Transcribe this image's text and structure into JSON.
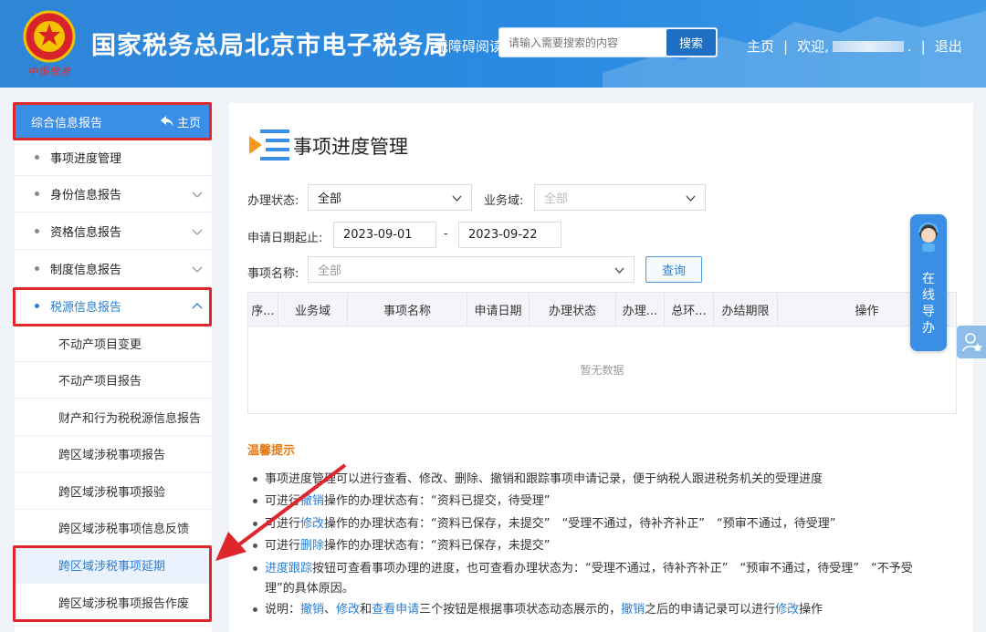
{
  "header": {
    "emblem_text": "中国税务",
    "site_title": "国家税务总局北京市电子税务局",
    "read_mode": "无障碍阅读",
    "search_placeholder": "请输入需要搜索的内容",
    "search_button": "搜索",
    "nav_home": "主页",
    "nav_sep": "|",
    "welcome": "欢迎,",
    "welcome_suffix": ".",
    "logout": "退出"
  },
  "sidebar": {
    "header_label": "综合信息报告",
    "home_label": "主页",
    "items": [
      {
        "label": "事项进度管理"
      },
      {
        "label": "身份信息报告"
      },
      {
        "label": "资格信息报告"
      },
      {
        "label": "制度信息报告"
      },
      {
        "label": "税源信息报告"
      }
    ],
    "sub_items": [
      {
        "label": "不动产项目变更"
      },
      {
        "label": "不动产项目报告"
      },
      {
        "label": "财产和行为税税源信息报告"
      },
      {
        "label": "跨区域涉税事项报告"
      },
      {
        "label": "跨区域涉税事项报验"
      },
      {
        "label": "跨区域涉税事项信息反馈"
      },
      {
        "label": "跨区域涉税事项延期"
      },
      {
        "label": "跨区域涉税事项报告作废"
      }
    ]
  },
  "main": {
    "title": "事项进度管理",
    "filters": {
      "status_label": "办理状态:",
      "status_value": "全部",
      "domain_label": "业务域:",
      "domain_value": "全部",
      "date_label": "申请日期起止:",
      "date_from": "2023-09-01",
      "date_sep": "-",
      "date_to": "2023-09-22",
      "item_label": "事项名称:",
      "item_value": "全部",
      "query_button": "查询"
    },
    "table": {
      "columns": [
        "序...",
        "业务域",
        "事项名称",
        "申请日期",
        "办理状态",
        "办理...",
        "总环...",
        "办结期限",
        "操作"
      ],
      "empty_text": "暂无数据"
    },
    "tips": {
      "title": "温馨提示",
      "line1": "事项进度管理可以进行查看、修改、删除、撤销和跟踪事项申请记录，便于纳税人跟进税务机关的受理进度",
      "line2_a": "可进行",
      "line2_link": "撤销",
      "line2_b": "操作的办理状态有：“资料已提交，待受理”",
      "line3_a": "可进行",
      "line3_link": "修改",
      "line3_b": "操作的办理状态有：“资料已保存，未提交”　“受理不通过，待补齐补正”　“预审不通过，待受理”",
      "line4_a": "可进行",
      "line4_link": "删除",
      "line4_b": "操作的办理状态有：“资料已保存，未提交”",
      "line5_link": "进度跟踪",
      "line5_b": "按钮可查看事项办理的进度，也可查看办理状态为：“受理不通过，待补齐补正”　“预审不通过，待受理”　“不予受",
      "line5_c": "理”的具体原因。",
      "line6_a": "说明：",
      "line6_l1": "撤销",
      "line6_s1": "、",
      "line6_l2": "修改",
      "line6_s2": "和",
      "line6_l3": "查看申请",
      "line6_b": "三个按钮是根据事项状态动态展示的，",
      "line6_l4": "撤销",
      "line6_c": "之后的申请记录可以进行",
      "line6_l5": "修改",
      "line6_d": "操作"
    }
  },
  "float_guide": {
    "label": "在线导办"
  },
  "colors": {
    "header_blue": "#2f86d8",
    "accent_blue": "#3a8ee6",
    "highlight_red": "#e0262d",
    "tip_orange": "#e8770f"
  }
}
